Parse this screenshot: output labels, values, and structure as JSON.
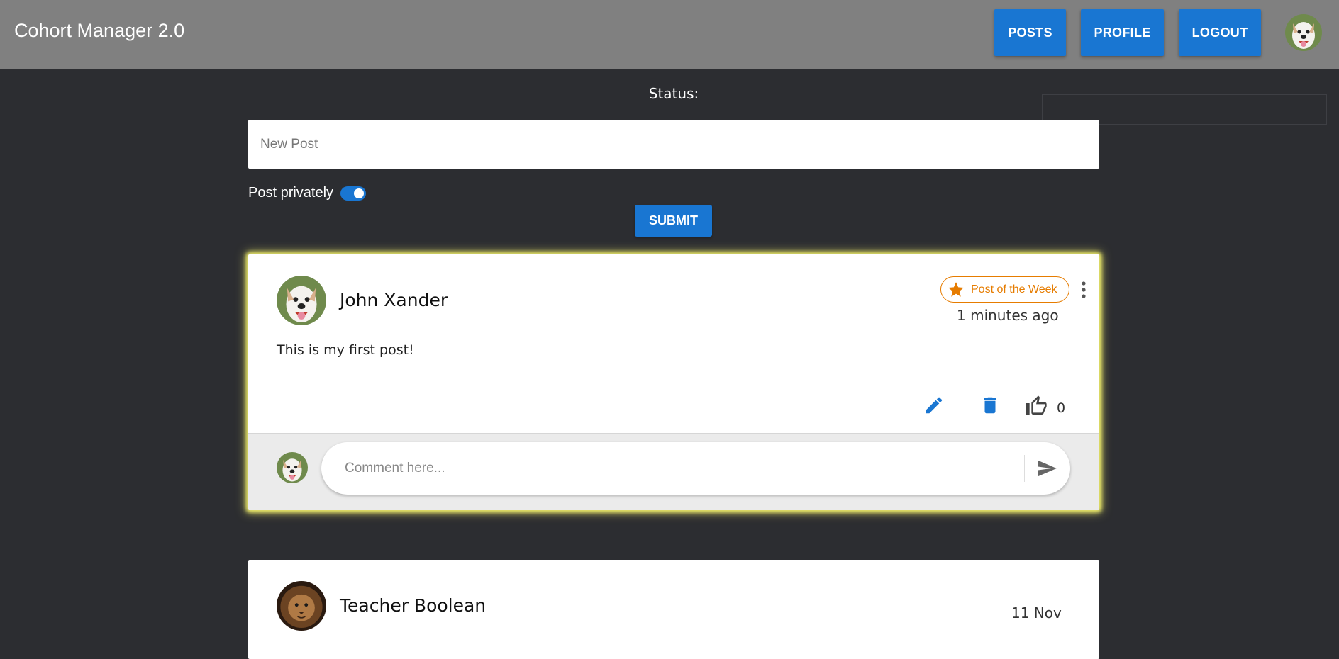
{
  "app": {
    "title": "Cohort Manager 2.0",
    "nav": {
      "posts": "POSTS",
      "profile": "PROFILE",
      "logout": "LOGOUT"
    },
    "accent_color": "#1976d2"
  },
  "composer": {
    "status_label": "Status:",
    "new_post_placeholder": "New Post",
    "post_privately_label": "Post privately",
    "post_privately_on": true,
    "submit_label": "SUBMIT"
  },
  "posts": [
    {
      "author": "John Xander",
      "badge": "Post of the Week",
      "time": "1 minutes ago",
      "text": "This is my first post!",
      "likes": "0",
      "comment_placeholder": "Comment here...",
      "avatar": "dog-avatar"
    },
    {
      "author": "Teacher Boolean",
      "time": "11 Nov",
      "avatar": "lion-avatar"
    }
  ]
}
